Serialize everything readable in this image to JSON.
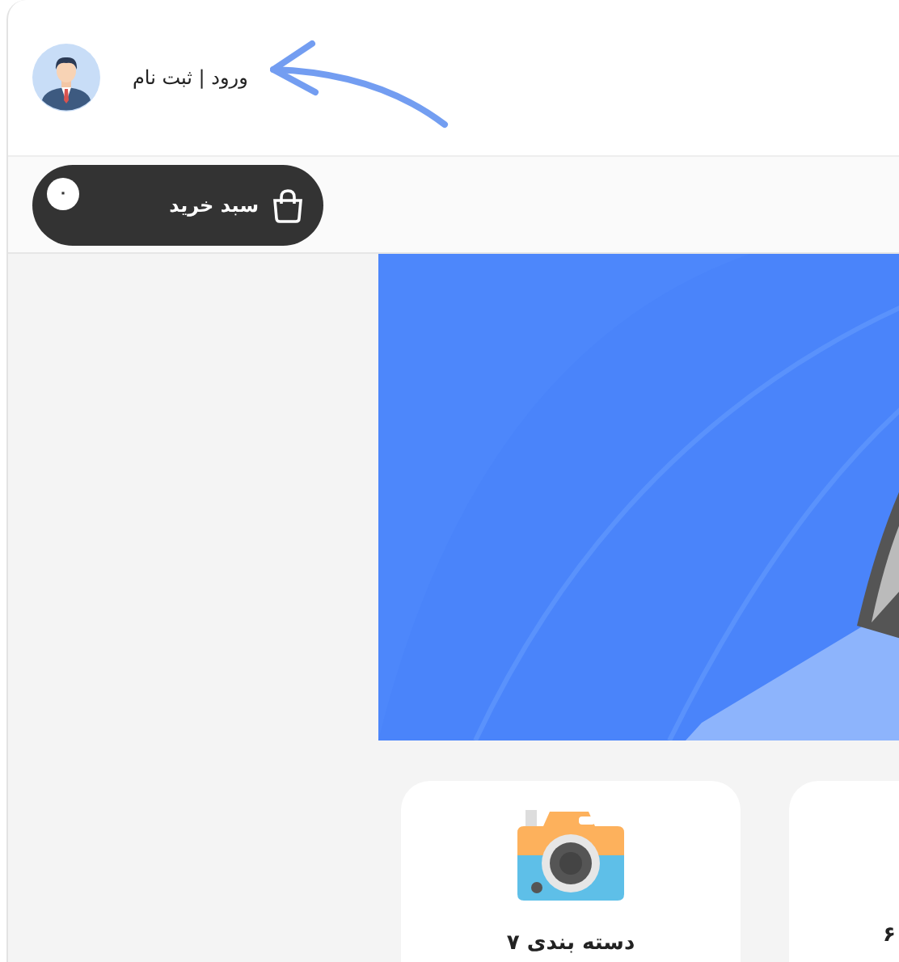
{
  "header": {
    "login_link": "ورود | ثبت نام"
  },
  "cart": {
    "label": "سبد خرید",
    "count": "۰"
  },
  "categories": [
    {
      "label": "۶"
    },
    {
      "label": "دسته بندی ۷"
    }
  ]
}
